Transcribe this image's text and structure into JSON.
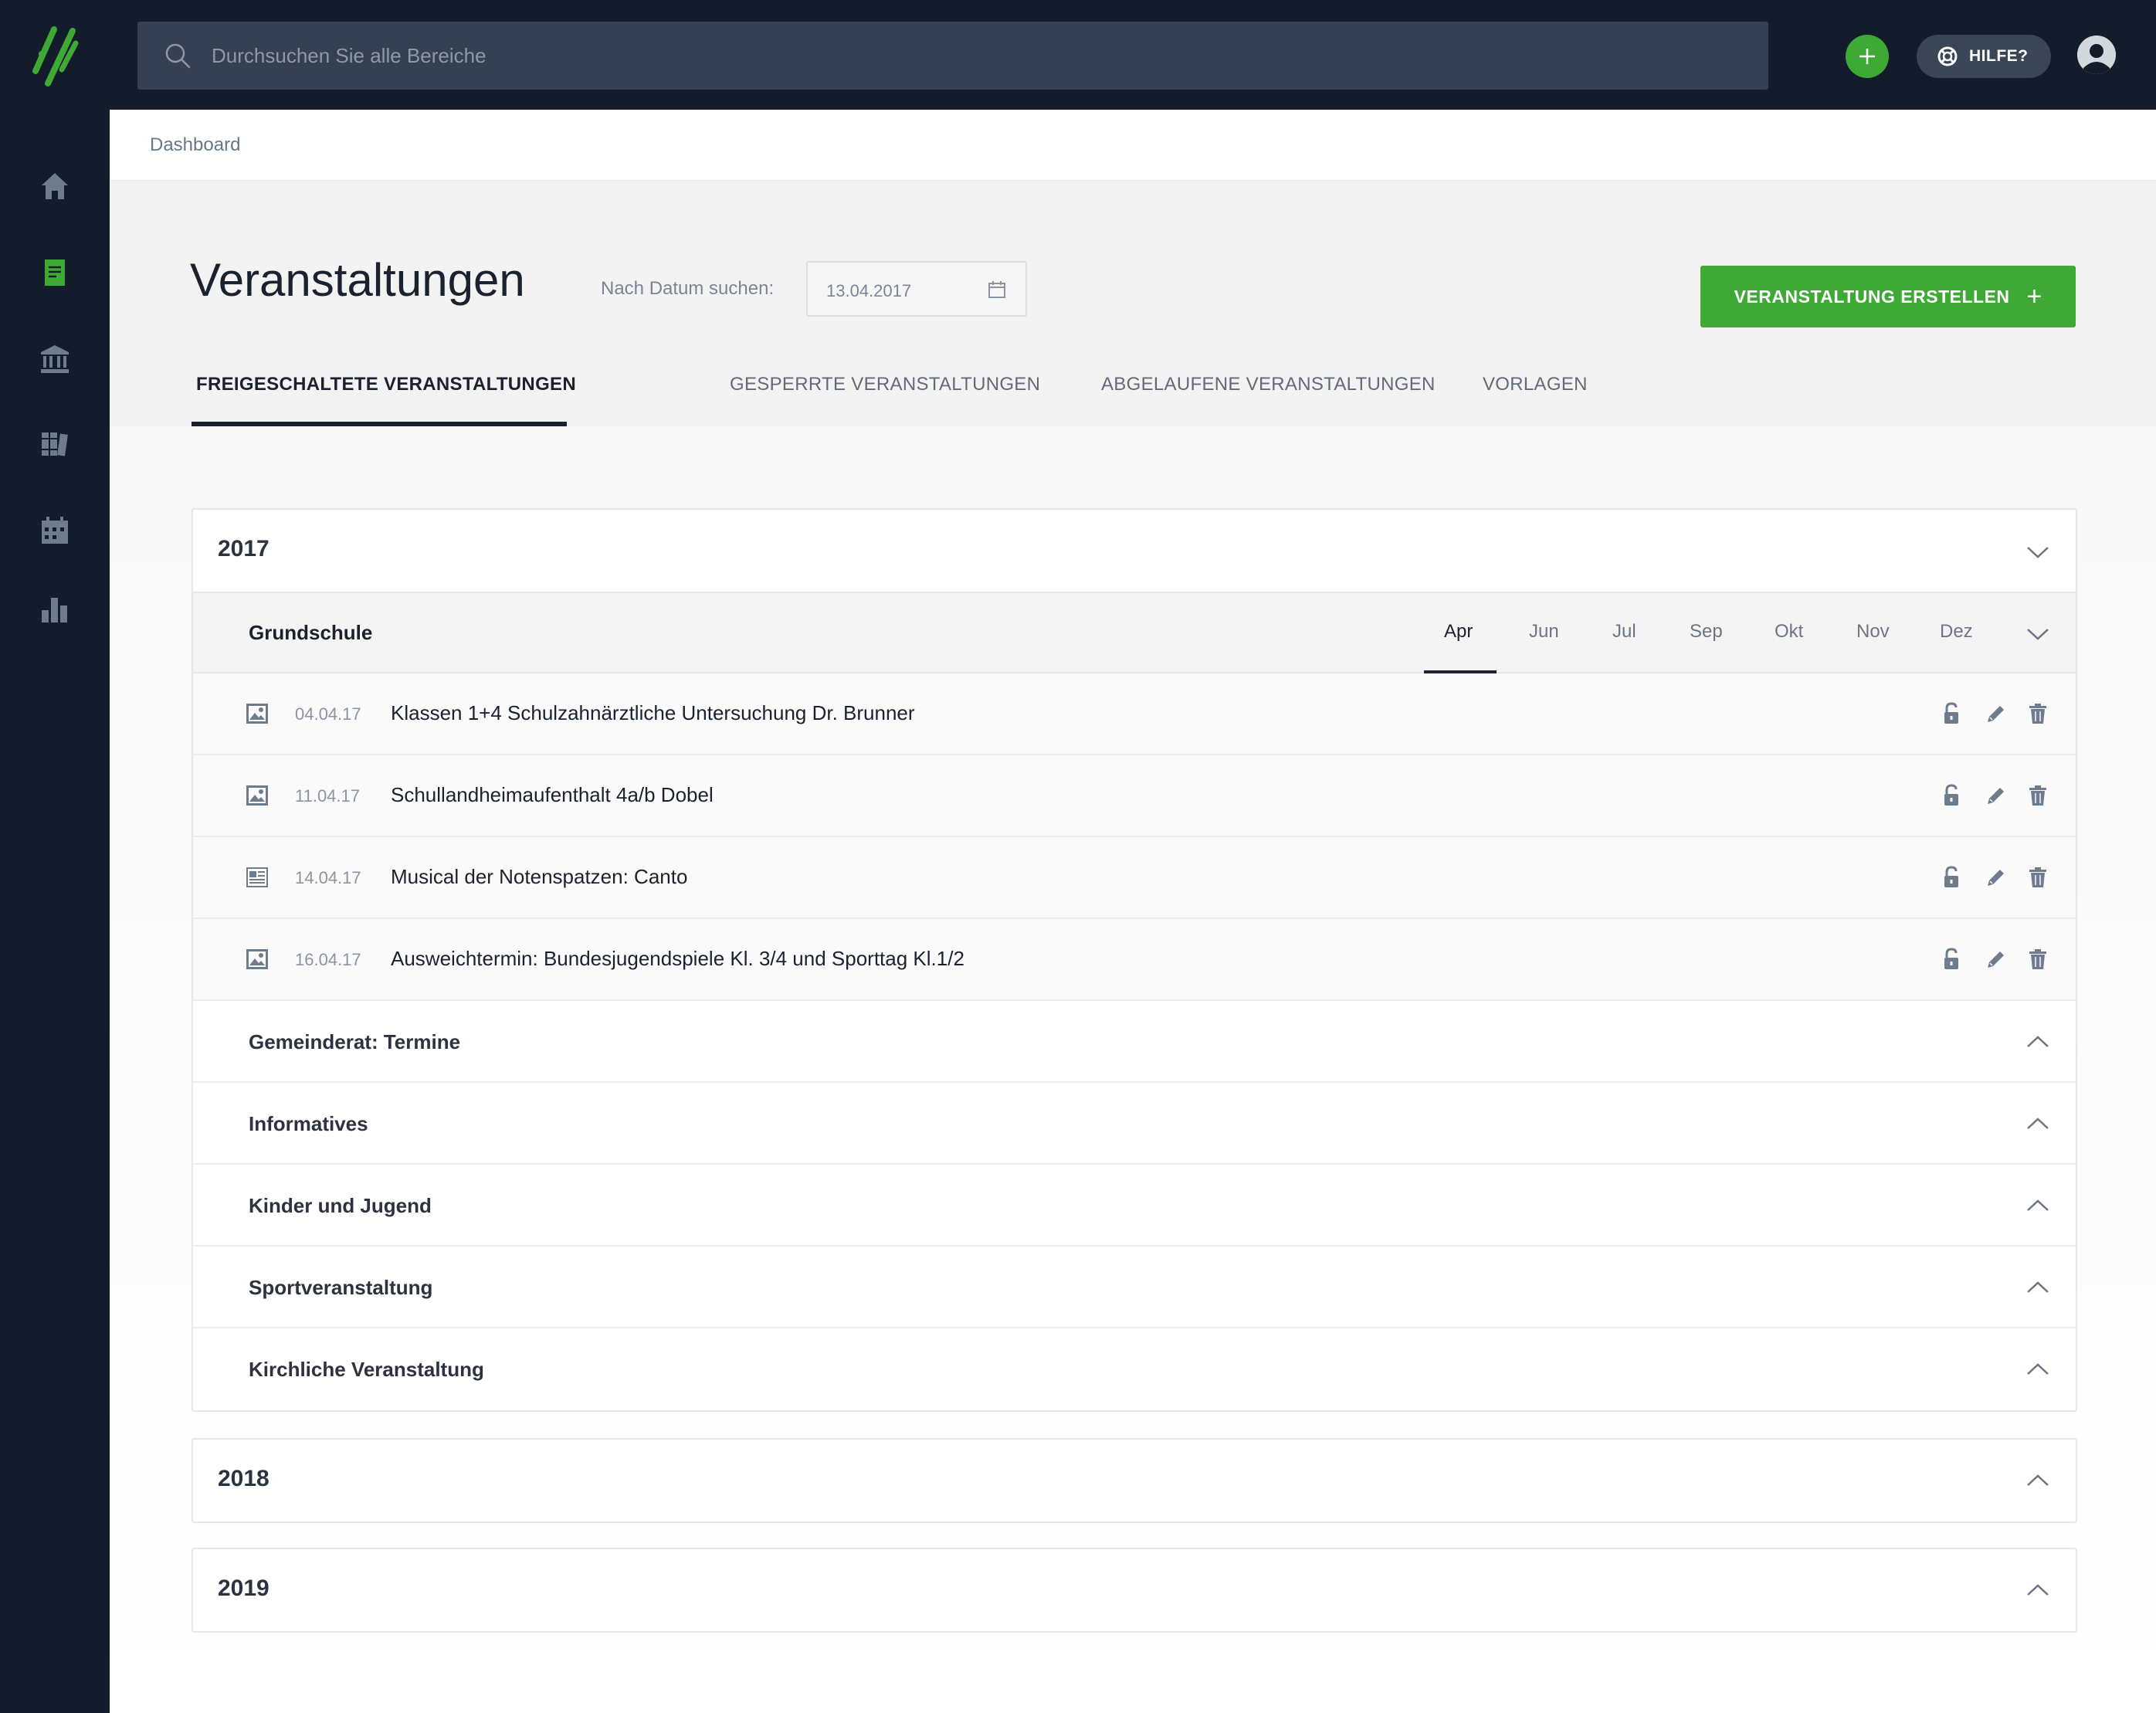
{
  "app": {
    "brand_color": "#3eaa35",
    "nav_color": "#121c2b"
  },
  "topbar": {
    "search_placeholder": "Durchsuchen Sie alle Bereiche",
    "help_label": "HILFE?"
  },
  "sidebar": {
    "items": [
      {
        "icon": "home-icon",
        "active": false
      },
      {
        "icon": "document-icon",
        "active": true
      },
      {
        "icon": "institution-icon",
        "active": false
      },
      {
        "icon": "books-icon",
        "active": false
      },
      {
        "icon": "calendar-icon",
        "active": false
      },
      {
        "icon": "bar-chart-icon",
        "active": false
      }
    ]
  },
  "breadcrumb": {
    "label": "Dashboard"
  },
  "header": {
    "title": "Veranstaltungen",
    "date_label": "Nach Datum suchen:",
    "date_value": "13.04.2017",
    "create_label": "VERANSTALTUNG ERSTELLEN",
    "create_plus": "+"
  },
  "tabs": [
    {
      "label": "FREIGESCHALTETE VERANSTALTUNGEN",
      "active": true
    },
    {
      "label": "GESPERRTE VERANSTALTUNGEN",
      "active": false
    },
    {
      "label": "ABGELAUFENE VERANSTALTUNGEN",
      "active": false
    },
    {
      "label": "VORLAGEN",
      "active": false
    }
  ],
  "years": [
    {
      "year": "2017",
      "expanded": true,
      "category": "Grundschule",
      "months": [
        "Apr",
        "Jun",
        "Jul",
        "Sep",
        "Okt",
        "Nov",
        "Dez"
      ],
      "active_month": "Apr",
      "events": [
        {
          "type_icon": "image-icon",
          "date": "04.04.17",
          "title": "Klassen 1+4 Schulzahnärztliche Untersuchung Dr. Brunner"
        },
        {
          "type_icon": "image-icon",
          "date": "11.04.17",
          "title": "Schullandheimaufenthalt 4a/b Dobel"
        },
        {
          "type_icon": "article-icon",
          "date": "14.04.17",
          "title": "Musical der Notenspatzen: Canto"
        },
        {
          "type_icon": "image-icon",
          "date": "16.04.17",
          "title": "Ausweichtermin: Bundesjugendspiele Kl. 3/4 und Sporttag Kl.1/2"
        }
      ],
      "other_categories": [
        "Gemeinderat: Termine",
        "Informatives",
        "Kinder und Jugend",
        "Sportveranstaltung",
        "Kirchliche Veranstaltung"
      ]
    },
    {
      "year": "2018",
      "expanded": false
    },
    {
      "year": "2019",
      "expanded": false
    }
  ]
}
